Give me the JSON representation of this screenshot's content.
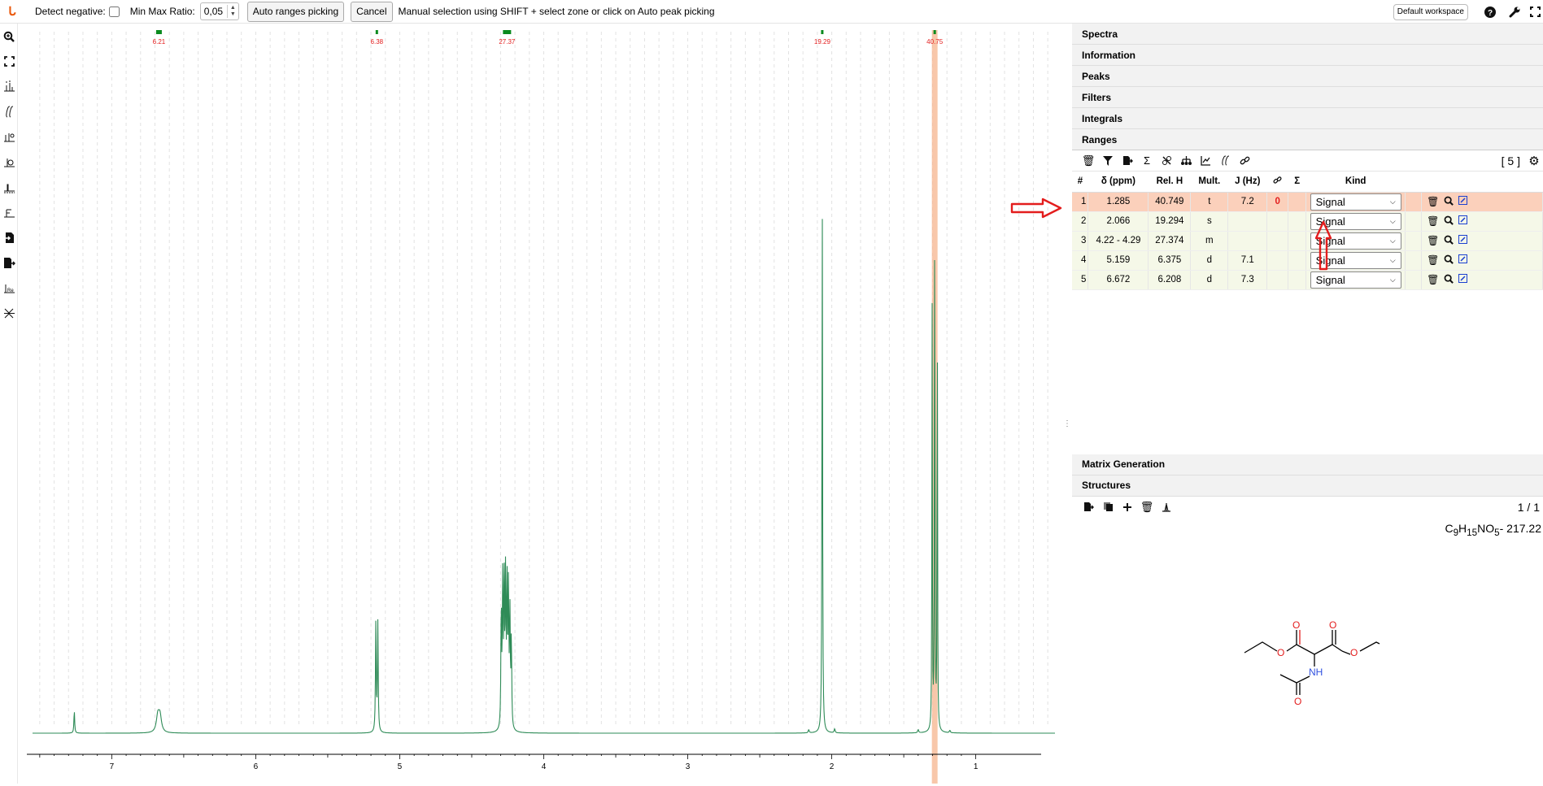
{
  "toolbar": {
    "detect_negative_label": "Detect negative:",
    "min_max_ratio_label": "Min Max Ratio:",
    "min_max_ratio_value": "0,05",
    "auto_ranges_label": "Auto ranges picking",
    "cancel_label": "Cancel",
    "message": "Manual selection using SHIFT + select zone or click on Auto peak picking",
    "workspace_label": "Default workspace"
  },
  "left_tools": [
    "zoom-icon",
    "full-zoom-icon",
    "peak-picking-icon",
    "integral-icon",
    "zero-filling-icon",
    "phase-correction-icon",
    "baseline-correction-icon",
    "exclusion-zones-icon",
    "import-icon",
    "export-icon",
    "exchange-icon",
    "multiple-analysis-icon"
  ],
  "spectrum": {
    "x_axis": {
      "min": 0.45,
      "max": 7.55,
      "ticks": [
        "7",
        "6",
        "5",
        "4",
        "3",
        "2",
        "1"
      ]
    },
    "range_labels": [
      {
        "ppm": 6.672,
        "label": "6.21"
      },
      {
        "ppm": 5.159,
        "label": "6.38"
      },
      {
        "ppm": 4.255,
        "label": "27.37"
      },
      {
        "ppm": 2.066,
        "label": "19.29"
      },
      {
        "ppm": 1.285,
        "label": "40.75"
      }
    ],
    "trace_color": "#2e8b57",
    "highlight_ppm": 1.285
  },
  "panel": {
    "accordions": [
      "Spectra",
      "Information",
      "Peaks",
      "Filters",
      "Integrals",
      "Ranges"
    ],
    "ranges_count": "[ 5 ]",
    "columns": [
      "#",
      "δ (ppm)",
      "Rel. H",
      "Mult.",
      "J (Hz)",
      "",
      "Σ",
      "Kind"
    ],
    "rows": [
      {
        "num": "1",
        "delta": "1.285",
        "relh": "40.749",
        "mult": "t",
        "j": "7.2",
        "link": "0",
        "kind": "Signal"
      },
      {
        "num": "2",
        "delta": "2.066",
        "relh": "19.294",
        "mult": "s",
        "j": "",
        "link": "",
        "kind": "Signal"
      },
      {
        "num": "3",
        "delta": "4.22 - 4.29",
        "relh": "27.374",
        "mult": "m",
        "j": "",
        "link": "",
        "kind": "Signal"
      },
      {
        "num": "4",
        "delta": "5.159",
        "relh": "6.375",
        "mult": "d",
        "j": "7.1",
        "link": "",
        "kind": "Signal"
      },
      {
        "num": "5",
        "delta": "6.672",
        "relh": "6.208",
        "mult": "d",
        "j": "7.3",
        "link": "",
        "kind": "Signal"
      }
    ],
    "matrix_generation_label": "Matrix Generation",
    "structures_label": "Structures",
    "structures_page": "1 / 1",
    "formula_prefix": "C",
    "formula_c": "9",
    "formula_h": "15",
    "formula_rest": "NO",
    "formula_o": "5",
    "formula_mass": "- 217.22",
    "molecule_labels": {
      "nh": "NH"
    }
  }
}
